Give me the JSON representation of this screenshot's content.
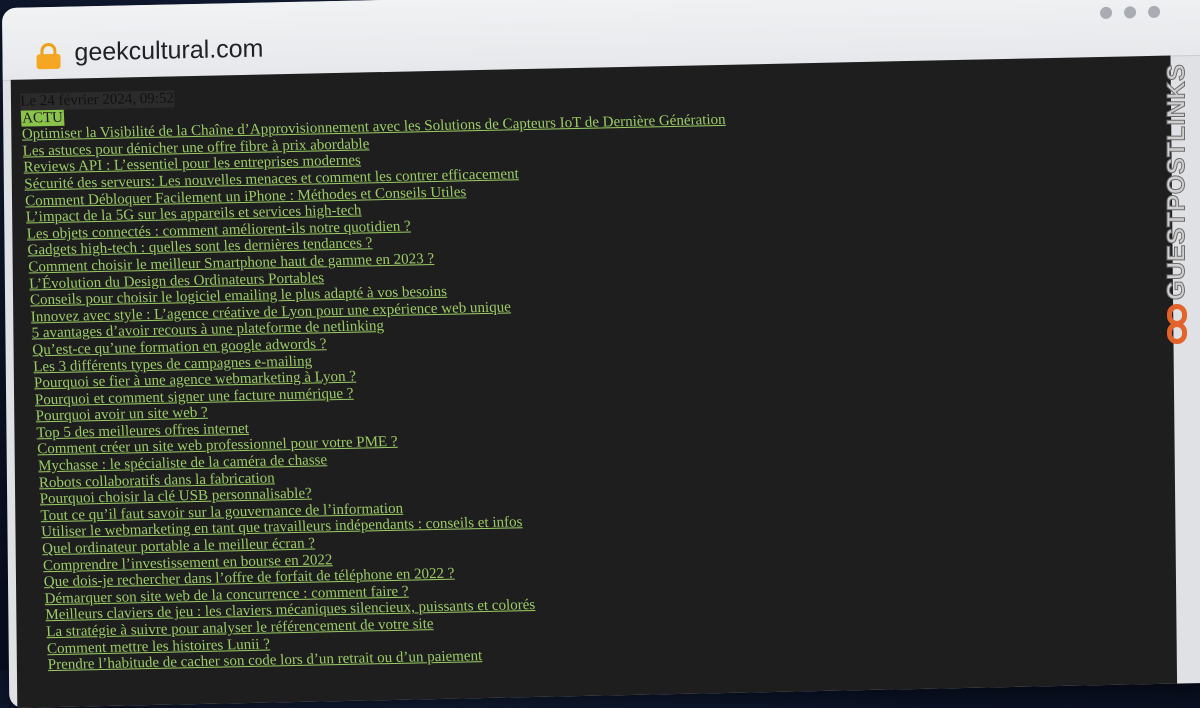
{
  "browser": {
    "url": "geekcultural.com",
    "lock_icon": "lock-icon",
    "window_controls": [
      "dot",
      "dot",
      "dot"
    ]
  },
  "page": {
    "date_text": "Le 24 février 2024, 09:52",
    "category_tag": "ACTU",
    "articles": [
      "Optimiser la Visibilité de la Chaîne d’Approvisionnement avec les Solutions de Capteurs IoT de Dernière Génération",
      "Les astuces pour dénicher une offre fibre à prix abordable",
      "Reviews API : L’essentiel pour les entreprises modernes",
      "Sécurité des serveurs: Les nouvelles menaces et comment les contrer efficacement",
      "Comment Débloquer Facilement un iPhone : Méthodes et Conseils Utiles",
      "L’impact de la 5G sur les appareils et services high-tech",
      "Les objets connectés : comment améliorent-ils notre quotidien ?",
      "Gadgets high-tech : quelles sont les dernières tendances ?",
      "Comment choisir le meilleur Smartphone haut de gamme en 2023 ?",
      "L’Évolution du Design des Ordinateurs Portables",
      "Conseils pour choisir le logiciel emailing  le plus adapté à vos besoins",
      "Innovez avec style : L’agence créative de Lyon pour une expérience web unique",
      "5 avantages d’avoir recours à une plateforme de netlinking",
      "Qu’est-ce qu’une formation en google adwords ?",
      "Les 3 différents types de campagnes e-mailing",
      "Pourquoi se fier à une agence webmarketing à Lyon ?",
      "Pourquoi et comment signer une facture numérique ?",
      "Pourquoi avoir un site web ?",
      "Top 5 des meilleures offres internet",
      "Comment créer un site web professionnel pour votre PME ?",
      "Mychasse : le spécialiste de la caméra de chasse",
      "Robots collaboratifs dans la fabrication",
      "Pourquoi choisir la clé USB personnalisable?",
      "Tout ce qu’il faut savoir sur la gouvernance de l’information",
      "Utiliser le webmarketing en tant que travailleurs indépendants : conseils et infos",
      "Quel ordinateur portable a le meilleur écran ?",
      "Comprendre l’investissement en bourse en 2022",
      "Que dois-je rechercher dans l’offre de forfait de téléphone en 2022 ?",
      "Démarquer son site web de la concurrence : comment faire ?",
      "Meilleurs claviers de jeu : les claviers mécaniques silencieux, puissants et colorés",
      "La stratégie à suivre pour analyser le référencement de votre site",
      "Comment mettre les histoires Lunii ?",
      "Prendre l’habitude de cacher son code lors d’un retrait ou d’un paiement"
    ]
  },
  "badge": {
    "text": "GUESTPOSTLINKS",
    "icon": "chain-link-icon"
  },
  "colors": {
    "link": "#9ccc65",
    "tag_bg": "#8bc34a",
    "page_bg": "#1e1e1e",
    "badge_icon": "#e2632c"
  }
}
